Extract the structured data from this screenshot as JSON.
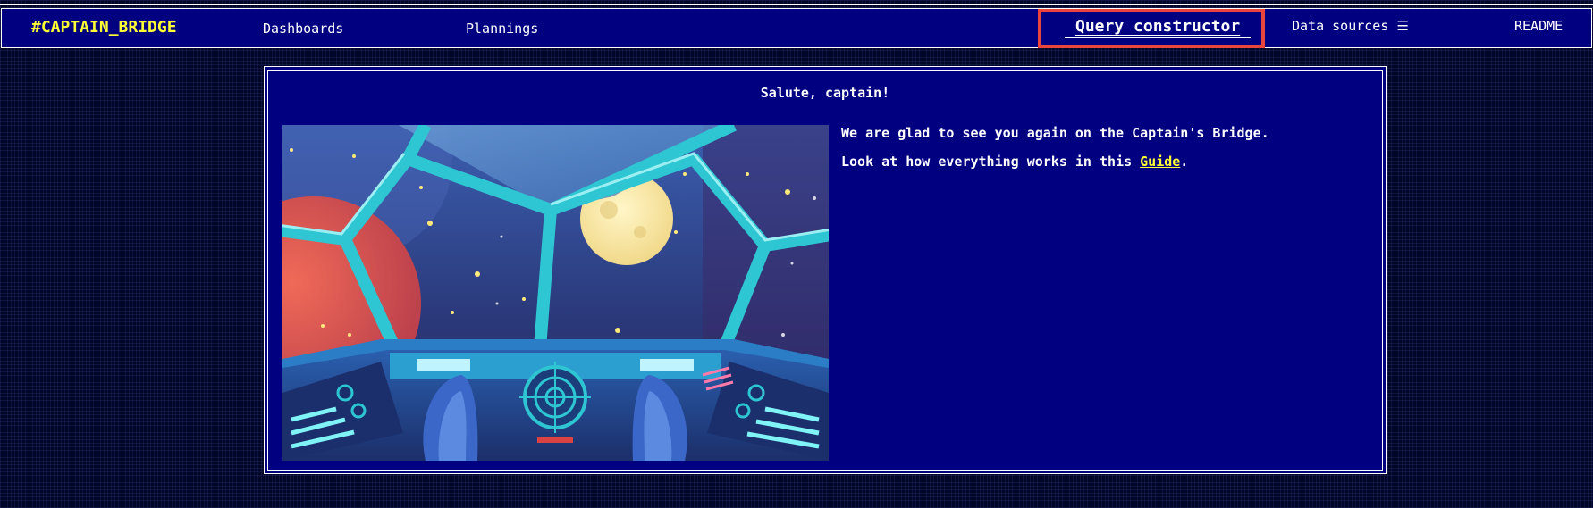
{
  "nav": {
    "brand": "#CAPTAIN_BRIDGE",
    "dashboards": "Dashboards",
    "plannings": "Plannings",
    "query_constructor": "Query constructor",
    "data_sources": "Data sources ☰",
    "readme": "README"
  },
  "welcome": {
    "greeting": "Salute, captain!",
    "line1": "We are glad to see you again on the Captain's Bridge.",
    "line2_prefix": "Look at how everything works in this ",
    "guide_link": "Guide",
    "line2_suffix": "."
  },
  "illustration": {
    "icon": "spaceship-cockpit-illustration"
  },
  "colors": {
    "nav_bg": "#000080",
    "brand": "#ffff33",
    "highlight": "#e8463c",
    "page_bg": "#010526"
  }
}
